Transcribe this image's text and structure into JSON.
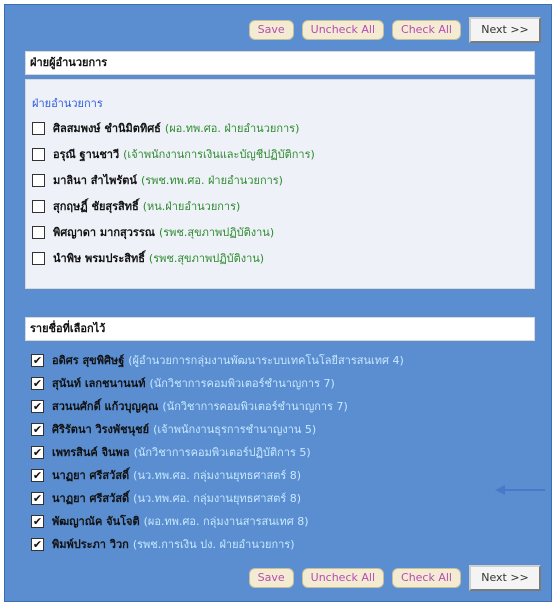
{
  "toolbar": {
    "save_label": "Save",
    "uncheck_all_label": "Uncheck All",
    "check_all_label": "Check All",
    "next_label": "Next >>"
  },
  "available": {
    "header": "ฝ่ายผู้อำนวยการ",
    "group_label": "ฝ่ายอำนวยการ",
    "items": [
      {
        "name": "ศิลสมพงษ์ ชำนิมิตทิศธ์",
        "title": "(ผอ.ทพ.ศอ. ฝ่ายอำนวยการ)",
        "checked": false
      },
      {
        "name": "อรุณี ฐานชาวี",
        "title": "(เจ้าพนักงานการเงินและบัญชีปฏิบัติการ)",
        "checked": false
      },
      {
        "name": "มาลินา สำไพรัตน์",
        "title": "(รพช.ทพ.ศอ. ฝ่ายอำนวยการ)",
        "checked": false
      },
      {
        "name": "สุกฤษฏิ์ ชัยสุรสิทธิ์",
        "title": "(หน.ฝ่ายอำนวยการ)",
        "checked": false
      },
      {
        "name": "พิศญาดา มากสุวรรณ",
        "title": "(รพช.สุขภาพปฏิบัติงาน)",
        "checked": false
      },
      {
        "name": "นำพิษ พรมประสิทธิ์",
        "title": "(รพช.สุขภาพปฏิบัติงาน)",
        "checked": false
      }
    ]
  },
  "selected": {
    "header": "รายชื่อที่เลือกไว้",
    "items": [
      {
        "name": "อดิศร สุขพิศิษฐ์",
        "title": "(ผู้อำนวยการกลุ่มงานพัฒนาระบบเทคโนโลยีสารสนเทศ 4)",
        "checked": true
      },
      {
        "name": "สุนันท์ เลกชนานนท์",
        "title": "(นักวิชาการคอมพิวเตอร์ชำนาญการ 7)",
        "checked": true
      },
      {
        "name": "สวนนศักดิ์ แก้วบุญคุณ",
        "title": "(นักวิชาการคอมพิวเตอร์ชำนาญการ 7)",
        "checked": true
      },
      {
        "name": "ศิริรัตนา วิรงพัชนุชย์",
        "title": "(เจ้าพนักงานธุรการชำนาญงาน 5)",
        "checked": true
      },
      {
        "name": "เพทรสินค์ จินพล",
        "title": "(นักวิชาการคอมพิวเตอร์ปฏิบัติการ 5)",
        "checked": true
      },
      {
        "name": "นาฏยา ศรีสวัสดิ์",
        "title": "(นว.ทพ.ศอ. กลุ่มงานยุทธศาสตร์ 8)",
        "checked": true
      },
      {
        "name": "นาฏยา ศรีสวัสดิ์",
        "title": "(นว.ทพ.ศอ. กลุ่มงานยุทธศาสตร์ 8)",
        "checked": true
      },
      {
        "name": "พัฒญาณัค จันโจติ",
        "title": "(ผอ.ทพ.ศอ. กลุ่มงานสารสนเทศ 8)",
        "checked": true
      },
      {
        "name": "พิมพ์ประภา วิวก",
        "title": "(รพช.การเงิน ปง. ฝ่ายอำนวยการ)",
        "checked": true
      }
    ]
  },
  "colors": {
    "panel": "#5a8ed0",
    "pill_bg": "#f3ecd2",
    "pill_text": "#b94ab4",
    "group_label": "#2a5ae0",
    "title_text": "#2f8a2f",
    "selected_title_text": "#c8e8ff",
    "arrow": "#4a78c8"
  }
}
